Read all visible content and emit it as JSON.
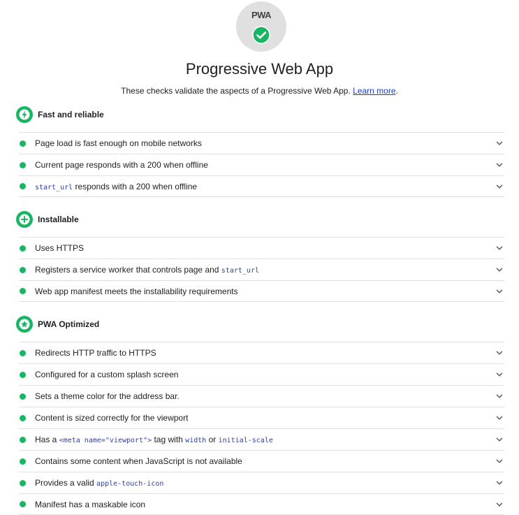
{
  "badge": {
    "text": "PWA",
    "status": "pass",
    "color": "#18b663"
  },
  "header": {
    "title": "Progressive Web App",
    "description": "These checks validate the aspects of a Progressive Web App.",
    "learn_more": "Learn more"
  },
  "colors": {
    "pass": "#18b663",
    "link": "#1a3ec1",
    "code": "#303f9f",
    "divider": "#e0e0e0"
  },
  "groups": [
    {
      "title": "Fast and reliable",
      "icon": "lightning-bolt-icon",
      "audits": [
        {
          "segments": [
            {
              "text": "Page load is fast enough on mobile networks",
              "code": false
            }
          ]
        },
        {
          "segments": [
            {
              "text": "Current page responds with a 200 when offline",
              "code": false
            }
          ]
        },
        {
          "segments": [
            {
              "text": "start_url",
              "code": true
            },
            {
              "text": " responds with a 200 when offline",
              "code": false
            }
          ]
        }
      ]
    },
    {
      "title": "Installable",
      "icon": "plus-icon",
      "audits": [
        {
          "segments": [
            {
              "text": "Uses HTTPS",
              "code": false
            }
          ]
        },
        {
          "segments": [
            {
              "text": "Registers a service worker that controls page and ",
              "code": false
            },
            {
              "text": "start_url",
              "code": true
            }
          ]
        },
        {
          "segments": [
            {
              "text": "Web app manifest meets the installability requirements",
              "code": false
            }
          ]
        }
      ]
    },
    {
      "title": "PWA Optimized",
      "icon": "star-icon",
      "audits": [
        {
          "segments": [
            {
              "text": "Redirects HTTP traffic to HTTPS",
              "code": false
            }
          ]
        },
        {
          "segments": [
            {
              "text": "Configured for a custom splash screen",
              "code": false
            }
          ]
        },
        {
          "segments": [
            {
              "text": "Sets a theme color for the address bar.",
              "code": false
            }
          ]
        },
        {
          "segments": [
            {
              "text": "Content is sized correctly for the viewport",
              "code": false
            }
          ]
        },
        {
          "segments": [
            {
              "text": "Has a ",
              "code": false
            },
            {
              "text": "<meta name=\"viewport\">",
              "code": true
            },
            {
              "text": " tag with ",
              "code": false
            },
            {
              "text": "width",
              "code": true
            },
            {
              "text": " or ",
              "code": false
            },
            {
              "text": "initial-scale",
              "code": true
            }
          ]
        },
        {
          "segments": [
            {
              "text": "Contains some content when JavaScript is not available",
              "code": false
            }
          ]
        },
        {
          "segments": [
            {
              "text": "Provides a valid ",
              "code": false
            },
            {
              "text": "apple-touch-icon",
              "code": true
            }
          ]
        },
        {
          "segments": [
            {
              "text": "Manifest has a maskable icon",
              "code": false
            }
          ]
        }
      ]
    }
  ]
}
